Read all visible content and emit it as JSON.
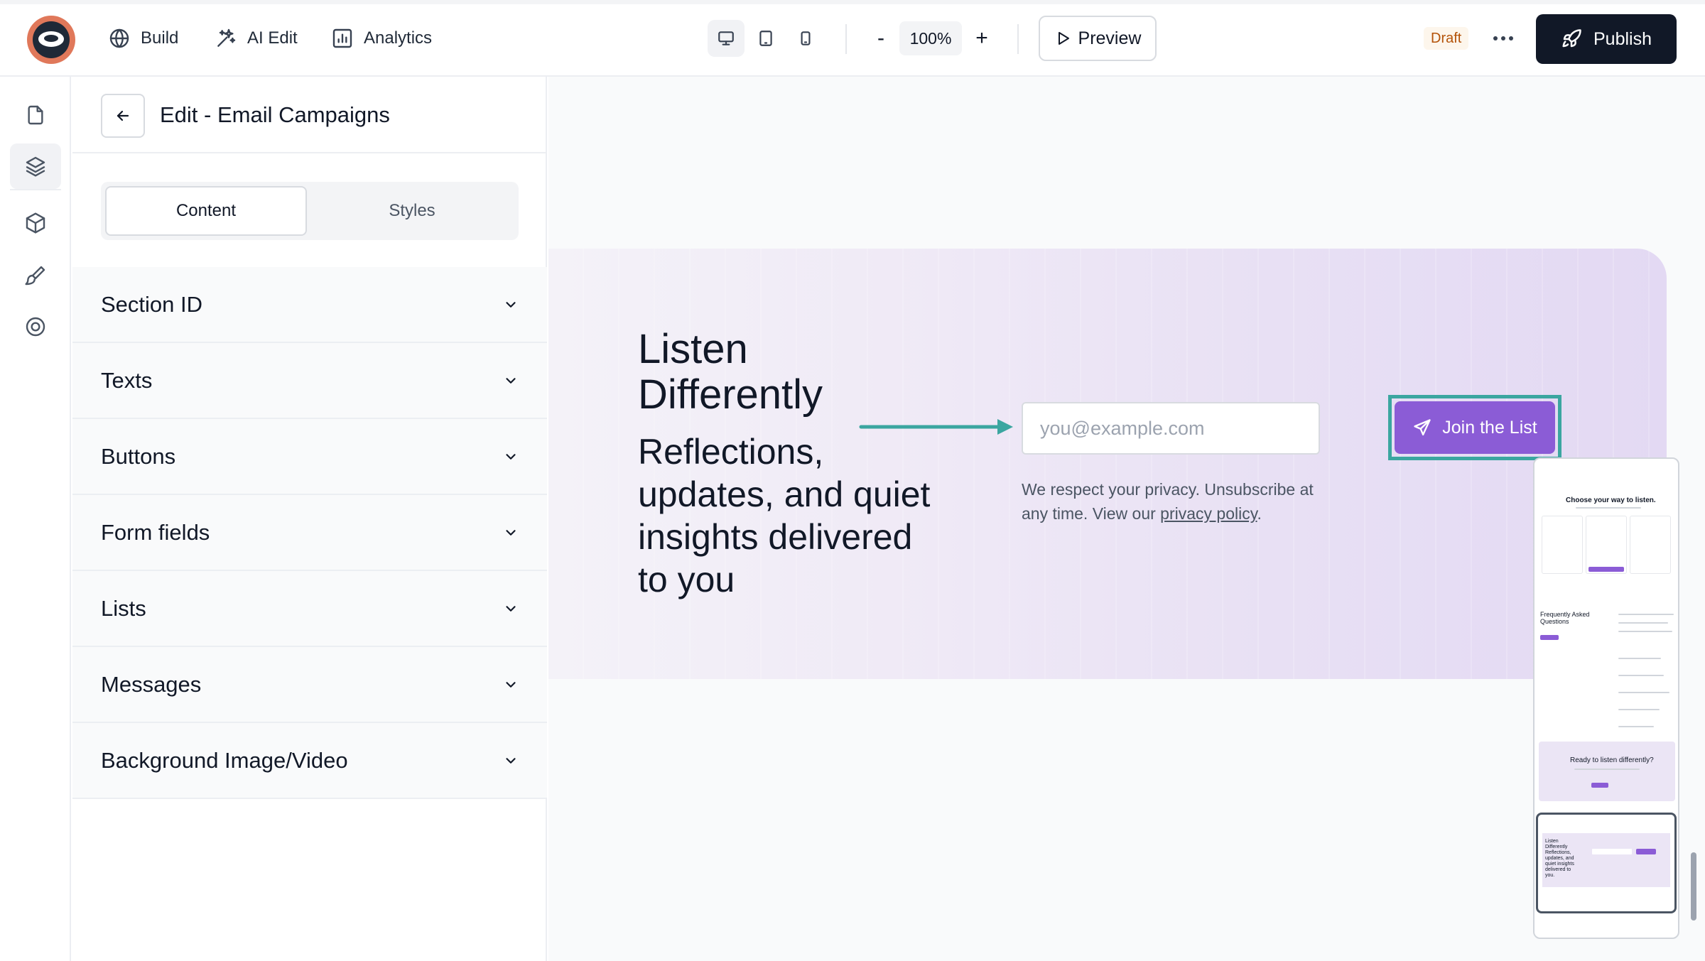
{
  "topbar": {
    "nav": [
      {
        "label": "Build",
        "icon": "globe-icon"
      },
      {
        "label": "AI Edit",
        "icon": "sparkles-icon"
      },
      {
        "label": "Analytics",
        "icon": "chart-icon"
      }
    ],
    "devices": [
      "desktop-icon",
      "tablet-icon",
      "mobile-icon"
    ],
    "zoom": {
      "minus": "-",
      "value": "100%",
      "plus": "+"
    },
    "preview_label": "Preview",
    "status": "Draft",
    "publish_label": "Publish"
  },
  "rail": {
    "items": [
      "page-icon",
      "layers-icon",
      "cube-icon",
      "brush-icon",
      "settings-icon"
    ],
    "active_index": 1
  },
  "panel": {
    "title": "Edit - Email Campaigns",
    "tabs": [
      {
        "label": "Content",
        "active": true
      },
      {
        "label": "Styles",
        "active": false
      }
    ],
    "sections": [
      "Section ID",
      "Texts",
      "Buttons",
      "Form fields",
      "Lists",
      "Messages",
      "Background Image/Video"
    ]
  },
  "canvas": {
    "headline": "Listen Differently",
    "subheadline": "Reflections, updates, and quiet insights delivered to you",
    "email_placeholder": "you@example.com",
    "join_label": "Join the List",
    "privacy_text": "We respect your privacy. Unsubscribe at any time. View our ",
    "privacy_link": "privacy policy",
    "privacy_end": "."
  },
  "minimap": {
    "pricing_title": "Choose your way to listen.",
    "faq_title": "Frequently Asked Questions",
    "cta_title": "Ready to listen differently?",
    "signup_text": "Listen Differently Reflections, updates, and quiet insights delivered to you."
  },
  "colors": {
    "accent": "#8b5cd6",
    "highlight": "#3ba6a0",
    "draft": "#b45309",
    "dark": "#111827"
  }
}
